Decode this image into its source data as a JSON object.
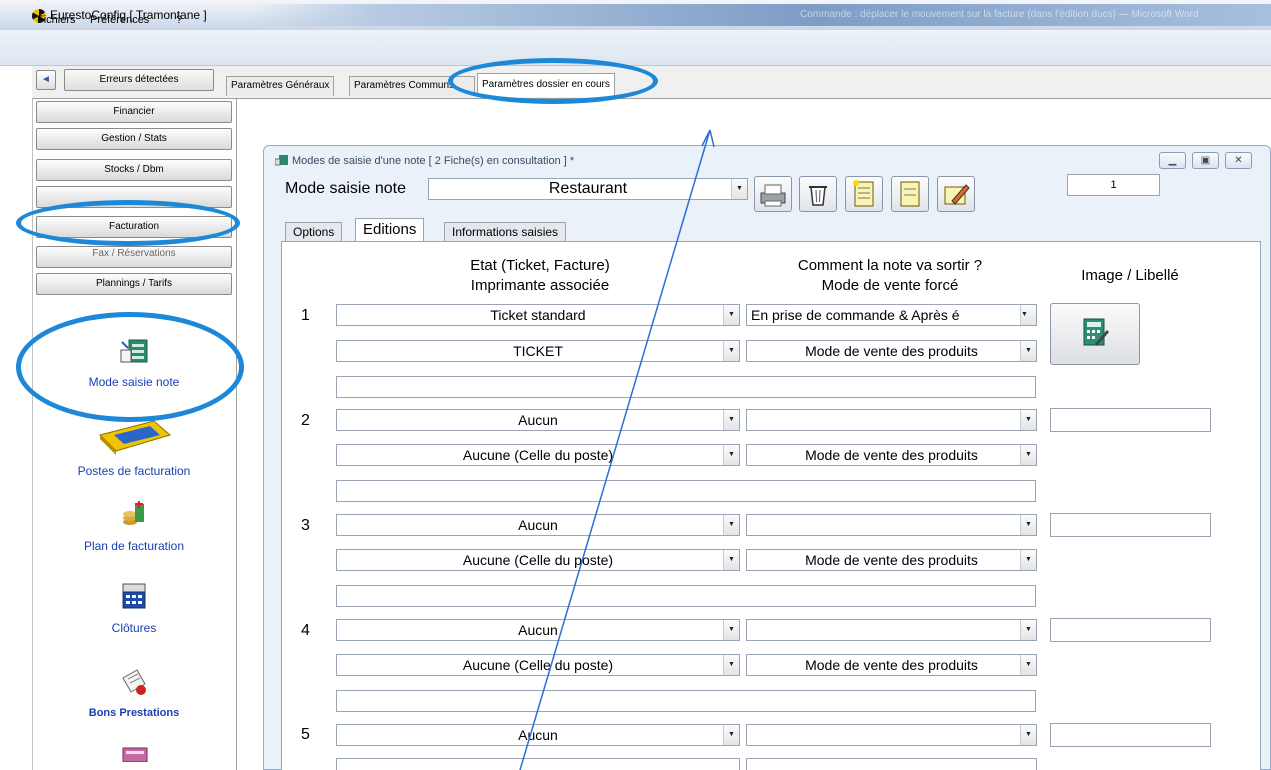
{
  "window": {
    "title": "EurestoConfig [ Tramontane ]",
    "ghost_text": "Commande : déplacer le mouvement sur la facture (dans l'édition ducs) — Microsoft Word"
  },
  "menu": {
    "items": [
      "Fichiers",
      "Préférences",
      "?"
    ]
  },
  "toolbar": {
    "back_icon": "◄",
    "errors_label": "Erreurs détectées"
  },
  "tabs": [
    "Paramètres Généraux",
    "Paramètres Communs",
    "Paramètres dossier en cours"
  ],
  "active_tab": "Paramètres dossier en cours",
  "sidebar": {
    "buttons": [
      "Financier",
      "Gestion / Stats",
      "Stocks / Dbm",
      "",
      "Facturation",
      "Fax / Réservations",
      "Plannings / Tarifs"
    ],
    "items": [
      "Mode saisie note",
      "Postes de facturation",
      "Plan de facturation",
      "Clôtures",
      "Bons Prestations"
    ]
  },
  "child": {
    "title": "Modes de saisie d'une note  [ 2 Fiche(s) en consultation ] *",
    "mode_label": "Mode saisie note",
    "mode_value": "Restaurant",
    "counter_value": "1",
    "inner_tabs": [
      "Options",
      "Editions",
      "Informations saisies"
    ],
    "active_inner_tab": "Editions",
    "headers": {
      "col1_line1": "Etat (Ticket, Facture)",
      "col1_line2": "Imprimante associée",
      "col2_line1": "Comment la note va sortir ?",
      "col2_line2": "Mode de vente forcé",
      "col3": "Image / Libellé"
    },
    "rows": [
      {
        "num": "1",
        "etat": "Ticket standard",
        "sortie": "En prise de commande & Après é",
        "imprimante": "TICKET",
        "mode_vente": "Mode de vente des produits"
      },
      {
        "num": "2",
        "etat": "Aucun",
        "sortie": "",
        "imprimante": "Aucune (Celle du poste)",
        "mode_vente": "Mode de vente des produits"
      },
      {
        "num": "3",
        "etat": "Aucun",
        "sortie": "",
        "imprimante": "Aucune (Celle du poste)",
        "mode_vente": "Mode de vente des produits"
      },
      {
        "num": "4",
        "etat": "Aucun",
        "sortie": "",
        "imprimante": "Aucune (Celle du poste)",
        "mode_vente": "Mode de vente des produits"
      },
      {
        "num": "5",
        "etat": "Aucun",
        "sortie": ""
      }
    ]
  },
  "colors": {
    "annotation": "#1e88d8",
    "nav_link": "#1a3fb0"
  }
}
